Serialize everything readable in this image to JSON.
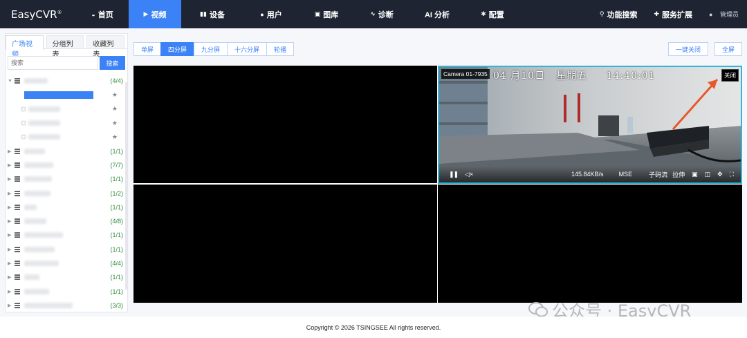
{
  "app": {
    "logo": "EasyCVR",
    "logo_mark": "®"
  },
  "nav": {
    "items": [
      {
        "label": "首页",
        "icon": "dashboard-icon"
      },
      {
        "label": "视频",
        "icon": "play-icon",
        "active": true
      },
      {
        "label": "设备",
        "icon": "device-icon"
      },
      {
        "label": "用户",
        "icon": "user-icon"
      },
      {
        "label": "图库",
        "icon": "gallery-icon"
      },
      {
        "label": "诊断",
        "icon": "pulse-icon"
      },
      {
        "label": "AI 分析",
        "icon": ""
      },
      {
        "label": "配置",
        "icon": "gear-icon"
      }
    ],
    "feature_search": "功能搜索",
    "service_ext": "服务扩展",
    "user": "管理员"
  },
  "sidebar": {
    "tabs": [
      "广场视频",
      "分组列表",
      "收藏列表"
    ],
    "search_placeholder": "搜索",
    "search_button": "搜索",
    "groups": [
      {
        "count": "(4/4)",
        "expanded": true
      },
      {
        "count": "(1/1)"
      },
      {
        "count": "(7/7)"
      },
      {
        "count": "(1/1)"
      },
      {
        "count": "(1/2)"
      },
      {
        "count": "(1/1)"
      },
      {
        "count": "(4/8)"
      },
      {
        "count": "(1/1)"
      },
      {
        "count": "(1/1)"
      },
      {
        "count": "(4/4)"
      },
      {
        "count": "(1/1)"
      },
      {
        "count": "(1/1)"
      },
      {
        "count": "(3/3)"
      }
    ]
  },
  "toolbar": {
    "layouts": [
      "单屏",
      "四分屏",
      "九分屏",
      "十六分屏",
      "轮播"
    ],
    "active_layout": "四分屏",
    "close_all": "一键关闭",
    "fullscreen": "全屏"
  },
  "player": {
    "camera_label": "Camera 01-7935",
    "osd_text": "04 月10日   星期五     14:40:01",
    "close": "关闭",
    "bitrate": "145.84KB/s",
    "mode": "MSE",
    "substream": "子码流",
    "stretch": "拉伸"
  },
  "watermark": "公众号 · EasyCVR",
  "footer": "Copyright © 2026 TSINGSEE All rights reserved.",
  "colors": {
    "accent": "#3b82f6",
    "nav_bg": "#1f2433",
    "active_border": "#34b4d8",
    "count_green": "#2e8b3a"
  }
}
